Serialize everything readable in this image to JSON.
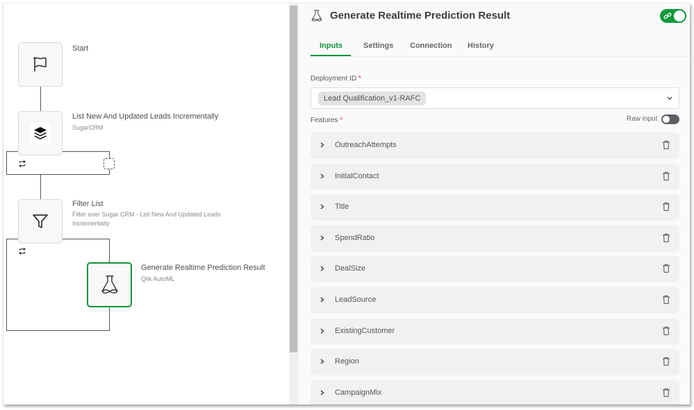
{
  "canvas": {
    "nodes": [
      {
        "id": "start",
        "title": "Start",
        "subtitle": "",
        "icon": "flag-icon"
      },
      {
        "id": "list-leads",
        "title": "List New And Updated Leads Incrementally",
        "subtitle": "SugarCRM",
        "icon": "layers-icon"
      },
      {
        "id": "filter-list",
        "title": "Filter List",
        "subtitle_line1": "Filter over Sugar CRM - List New And Updated Leads",
        "subtitle_line2": "Incrementally",
        "icon": "filter-icon"
      },
      {
        "id": "generate-prediction",
        "title": "Generate Realtime Prediction Result",
        "subtitle": "Qlik AutoML",
        "icon": "flask-icon",
        "selected": true
      }
    ],
    "loop_icon": "loop-icon"
  },
  "panel": {
    "title": "Generate Realtime Prediction Result",
    "title_icon": "flask-icon",
    "enabled_toggle": true,
    "tabs": [
      {
        "label": "Inputs",
        "active": true
      },
      {
        "label": "Settings",
        "active": false
      },
      {
        "label": "Connection",
        "active": false
      },
      {
        "label": "History",
        "active": false
      }
    ],
    "deployment_id": {
      "label": "Deployment ID",
      "required_mark": "*",
      "value": "Lead Qualification_v1-RAFC"
    },
    "features": {
      "label": "Features",
      "required_mark": "*",
      "raw_input_label": "Raw input",
      "raw_input_enabled": false,
      "items": [
        "OutreachAttempts",
        "InitialContact",
        "Title",
        "SpendRatio",
        "DealSize",
        "LeadSource",
        "ExistingCustomer",
        "Region",
        "CampaignMix"
      ]
    }
  },
  "colors": {
    "accent": "#11923c",
    "toggle_on": "#0f9a3c",
    "toggle_off": "#5f6066"
  }
}
